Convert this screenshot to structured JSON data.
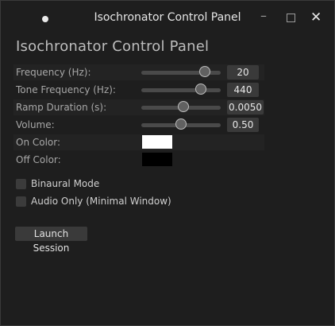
{
  "window": {
    "title": "Isochronator Control Panel"
  },
  "panel": {
    "heading": "Isochronator Control Panel",
    "sliders": [
      {
        "label": "Frequency (Hz):",
        "value": "20",
        "fraction": 0.8
      },
      {
        "label": "Tone Frequency (Hz):",
        "value": "440",
        "fraction": 0.75
      },
      {
        "label": "Ramp Duration (s):",
        "value": "0.0050",
        "fraction": 0.53
      },
      {
        "label": "Volume:",
        "value": "0.50",
        "fraction": 0.5
      }
    ],
    "colors": [
      {
        "label": "On Color:",
        "value": "#ffffff"
      },
      {
        "label": "Off Color:",
        "value": "#000000"
      }
    ],
    "checkboxes": [
      {
        "label": "Binaural Mode",
        "checked": false
      },
      {
        "label": "Audio Only (Minimal Window)",
        "checked": false
      }
    ],
    "launch_label": "Launch Session"
  }
}
